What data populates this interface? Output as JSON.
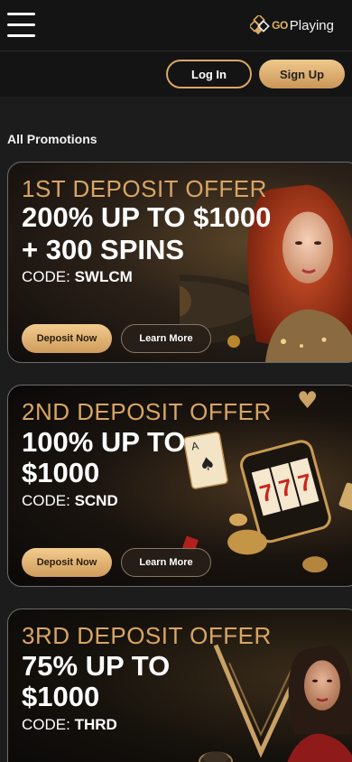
{
  "header": {
    "menu_icon": "hamburger-menu-icon",
    "logo_go": "GO",
    "logo_text": "Playing"
  },
  "auth": {
    "login_label": "Log In",
    "signup_label": "Sign Up"
  },
  "section_title": "All Promotions",
  "promos": [
    {
      "heading": "1ST DEPOSIT OFFER",
      "title_line1": "200% UP TO $1000",
      "title_line2": "+ 300 SPINS",
      "code_label": "CODE:",
      "code": "SWLCM",
      "deposit_label": "Deposit Now",
      "learn_label": "Learn More"
    },
    {
      "heading": "2ND DEPOSIT OFFER",
      "title_line1": "100% UP TO",
      "title_line2": "$1000",
      "code_label": "CODE:",
      "code": "SCND",
      "deposit_label": "Deposit Now",
      "learn_label": "Learn More"
    },
    {
      "heading": "3RD DEPOSIT OFFER",
      "title_line1": "75% UP TO",
      "title_line2": "$1000",
      "code_label": "CODE:",
      "code": "THRD"
    }
  ],
  "colors": {
    "accent_gold": "#d9a865",
    "heading_gold": "#d9a563",
    "background": "#1c1c1c"
  }
}
